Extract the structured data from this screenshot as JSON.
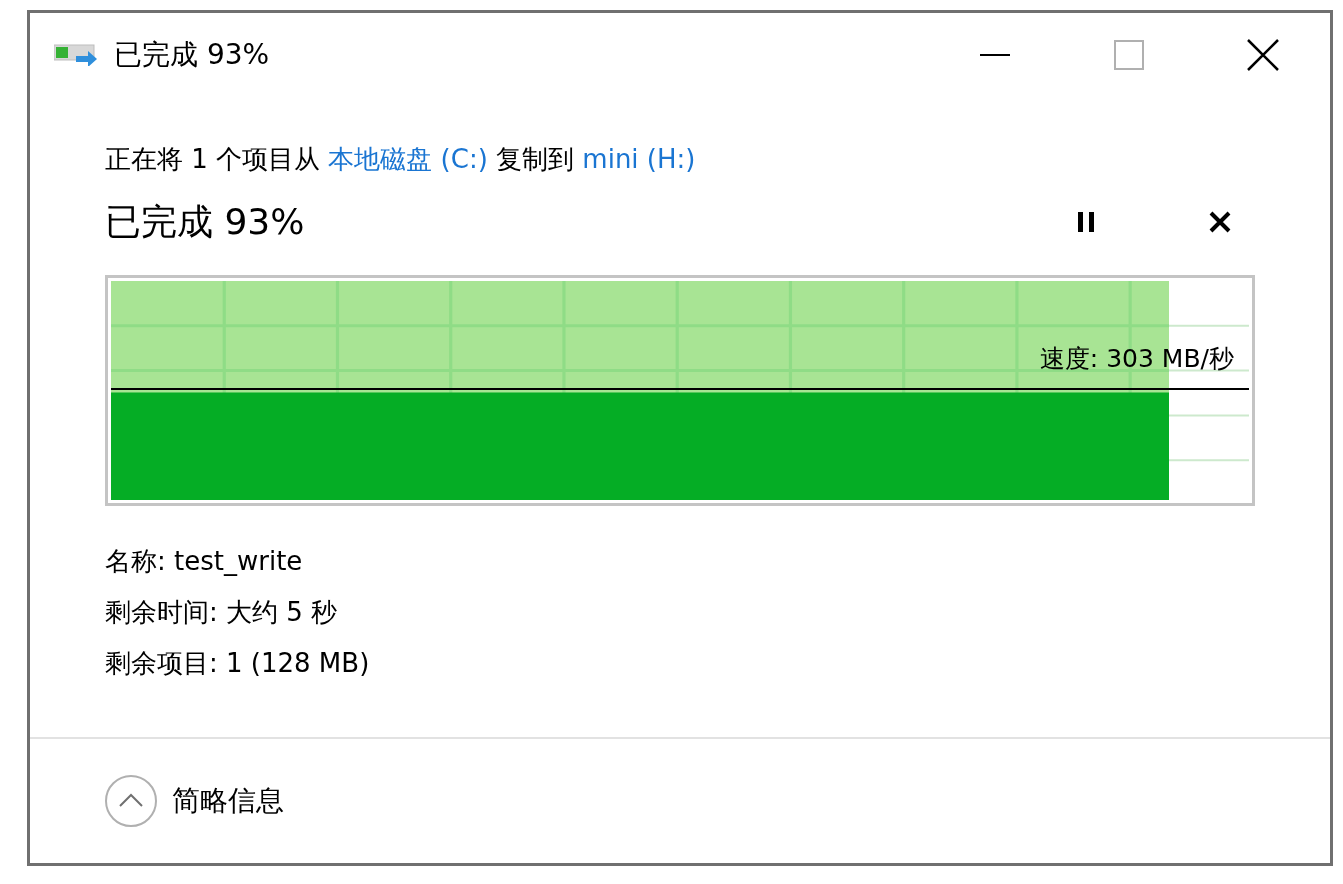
{
  "window": {
    "title": "已完成 93%"
  },
  "description": [
    {
      "kind": "text",
      "text": "正在将 1 个项目从 "
    },
    {
      "kind": "link",
      "text": "本地磁盘 (C:)"
    },
    {
      "kind": "text",
      "text": " 复制到 "
    },
    {
      "kind": "link",
      "text": "mini (H:)"
    }
  ],
  "progress": {
    "heading": "已完成 93%",
    "level": 0.93,
    "speed": "速度: 303 MB/秒"
  },
  "details": [
    "名称: test_write",
    "剩余时间: 大约 5 秒",
    "剩余项目: 1 (128 MB)"
  ],
  "footer": {
    "toggle": "简略信息"
  }
}
